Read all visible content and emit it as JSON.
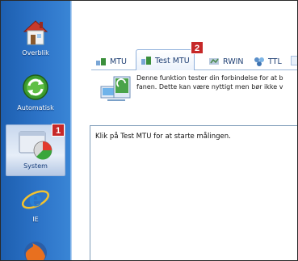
{
  "sidebar": {
    "items": [
      {
        "label": "Overblik",
        "icon": "house-icon"
      },
      {
        "label": "Automatisk",
        "icon": "refresh-icon"
      },
      {
        "label": "System",
        "icon": "system-chart-icon"
      },
      {
        "label": "IE",
        "icon": "internet-explorer-icon"
      },
      {
        "label": "",
        "icon": "firefox-icon"
      }
    ]
  },
  "tabs": [
    {
      "label": "MTU",
      "icon": "network-icon"
    },
    {
      "label": "Test MTU",
      "icon": "network-test-icon"
    },
    {
      "label": "RWIN",
      "icon": "rwin-icon"
    },
    {
      "label": "TTL",
      "icon": "ttl-icon"
    }
  ],
  "info": {
    "line1": "Denne funktion tester din forbindelse for at b",
    "line2": "fanen. Dette kan være nyttigt men bør ikke v"
  },
  "output": {
    "text": "Klik på Test MTU for at starte målingen."
  },
  "markers": {
    "m1": "1",
    "m2": "2"
  },
  "colors": {
    "sidebar": "#2d74c8",
    "marker": "#c62828",
    "tab_text": "#1f3f73"
  }
}
